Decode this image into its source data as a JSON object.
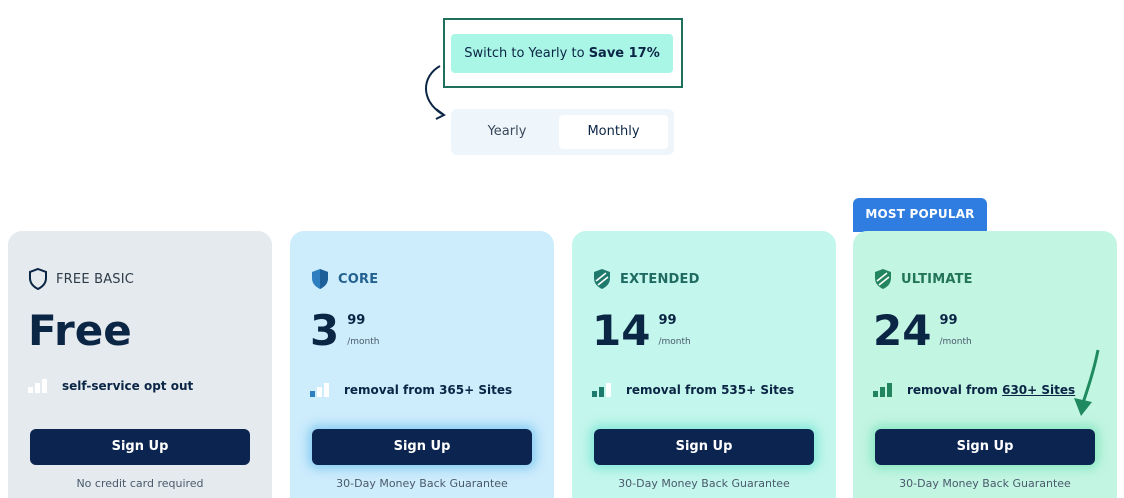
{
  "promo": {
    "prefix": "Switch to Yearly to ",
    "highlight": "Save 17%"
  },
  "billing_toggle": {
    "options": [
      "Yearly",
      "Monthly"
    ],
    "selected": "Monthly"
  },
  "badge": "MOST POPULAR",
  "plans": [
    {
      "name": "FREE BASIC",
      "price_main": "Free",
      "price_cents": "",
      "period": "",
      "feature_prefix": "self-service opt out",
      "feature_link": "",
      "button": "Sign Up",
      "note": "No credit card required",
      "shield_icon": "shield-outline-icon",
      "signal_level": 0
    },
    {
      "name": "CORE",
      "price_main": "3",
      "price_cents": "99",
      "period": "/month",
      "feature_prefix": "removal from 365+ Sites",
      "feature_link": "",
      "button": "Sign Up",
      "note": "30-Day Money Back Guarantee",
      "shield_icon": "shield-blue-icon",
      "signal_level": 1
    },
    {
      "name": "EXTENDED",
      "price_main": "14",
      "price_cents": "99",
      "period": "/month",
      "feature_prefix": "removal from 535+ Sites",
      "feature_link": "",
      "button": "Sign Up",
      "note": "30-Day Money Back Guarantee",
      "shield_icon": "shield-teal-icon",
      "signal_level": 2
    },
    {
      "name": "ULTIMATE",
      "price_main": "24",
      "price_cents": "99",
      "period": "/month",
      "feature_prefix": "removal from ",
      "feature_link": "630+ Sites",
      "button": "Sign Up",
      "note": "30-Day Money Back Guarantee",
      "shield_icon": "shield-green-icon",
      "signal_level": 3
    }
  ],
  "colors": {
    "accent": "#2f7de1",
    "button": "#0c2450",
    "promo": "#a9f5e6"
  }
}
